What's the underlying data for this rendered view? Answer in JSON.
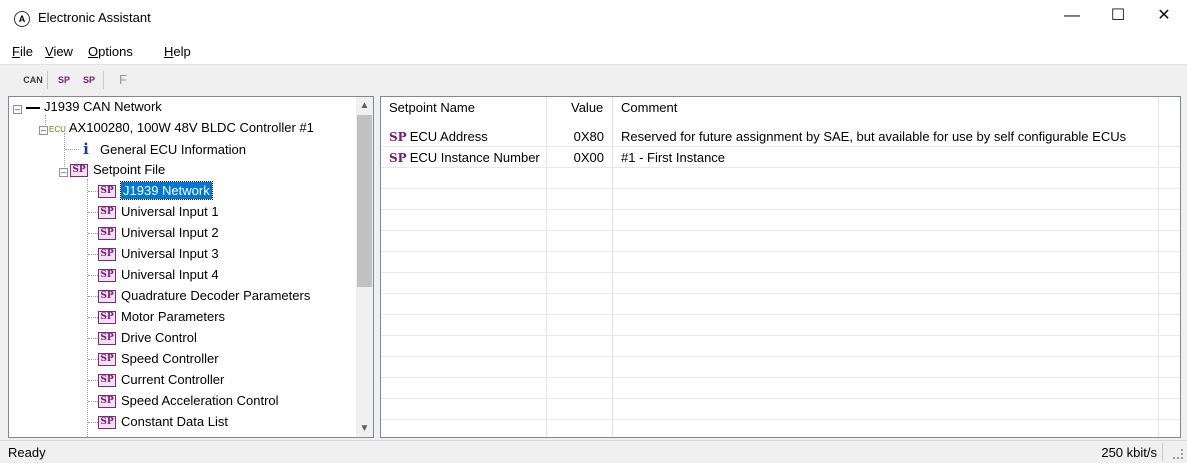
{
  "window": {
    "title": "Electronic Assistant"
  },
  "menu": [
    "File",
    "View",
    "Options",
    "Help"
  ],
  "toolbar": {
    "can_label": "CAN",
    "sp_label": "SP",
    "f_label": "F"
  },
  "tree": {
    "root": "J1939 CAN Network",
    "ecu_tag": "ECU",
    "ecu": "AX100280, 100W 48V BLDC Controller #1",
    "info": "General ECU Information",
    "setpoint_file": "Setpoint File",
    "sp_icon_text": "SP",
    "info_icon_text": "i",
    "items": [
      "J1939 Network",
      "Universal Input 1",
      "Universal Input 2",
      "Universal Input 3",
      "Universal Input 4",
      "Quadrature Decoder Parameters",
      "Motor Parameters",
      "Drive Control",
      "Speed Controller",
      "Current Controller",
      "Speed Acceleration Control",
      "Constant Data List"
    ],
    "selected_index": 0
  },
  "grid": {
    "headers": {
      "name": "Setpoint Name",
      "value": "Value",
      "comment": "Comment"
    },
    "sp_glyph": "SP",
    "rows": [
      {
        "name": "ECU Address",
        "value": "0X80",
        "comment": "Reserved for future assignment by SAE, but available for use by self configurable ECUs"
      },
      {
        "name": "ECU Instance Number",
        "value": "0X00",
        "comment": "#1 - First Instance"
      }
    ]
  },
  "status": {
    "text": "Ready",
    "baud": "250 kbit/s"
  }
}
